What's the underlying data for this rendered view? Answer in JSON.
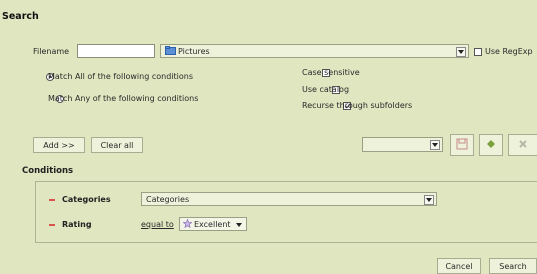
{
  "window_title": "Search",
  "filename": {
    "label": "Filename",
    "value": "",
    "folder_value": "Pictures",
    "regexp_label": "Use RegExp"
  },
  "match": {
    "all_label": "Match All of the following conditions",
    "any_label": "Match Any of the following conditions",
    "selected": "all"
  },
  "options": {
    "case_sensitive": "Case sensitive",
    "use_catalog": "Use catalog",
    "recurse": "Recurse through subfolders",
    "recurse_checked": true
  },
  "buttons": {
    "add": "Add >>",
    "clear_all": "Clear all",
    "cancel": "Cancel",
    "search": "Search"
  },
  "conditions": {
    "header": "Conditions",
    "rows": [
      {
        "field": "Categories",
        "value": "Categories"
      },
      {
        "field": "Rating",
        "operator": "equal to",
        "value": "Excellent"
      }
    ]
  },
  "icons": [
    "folder-icon",
    "save-icon",
    "add-icon",
    "remove-icon",
    "star-icon",
    "dropdown-arrow-icon"
  ]
}
